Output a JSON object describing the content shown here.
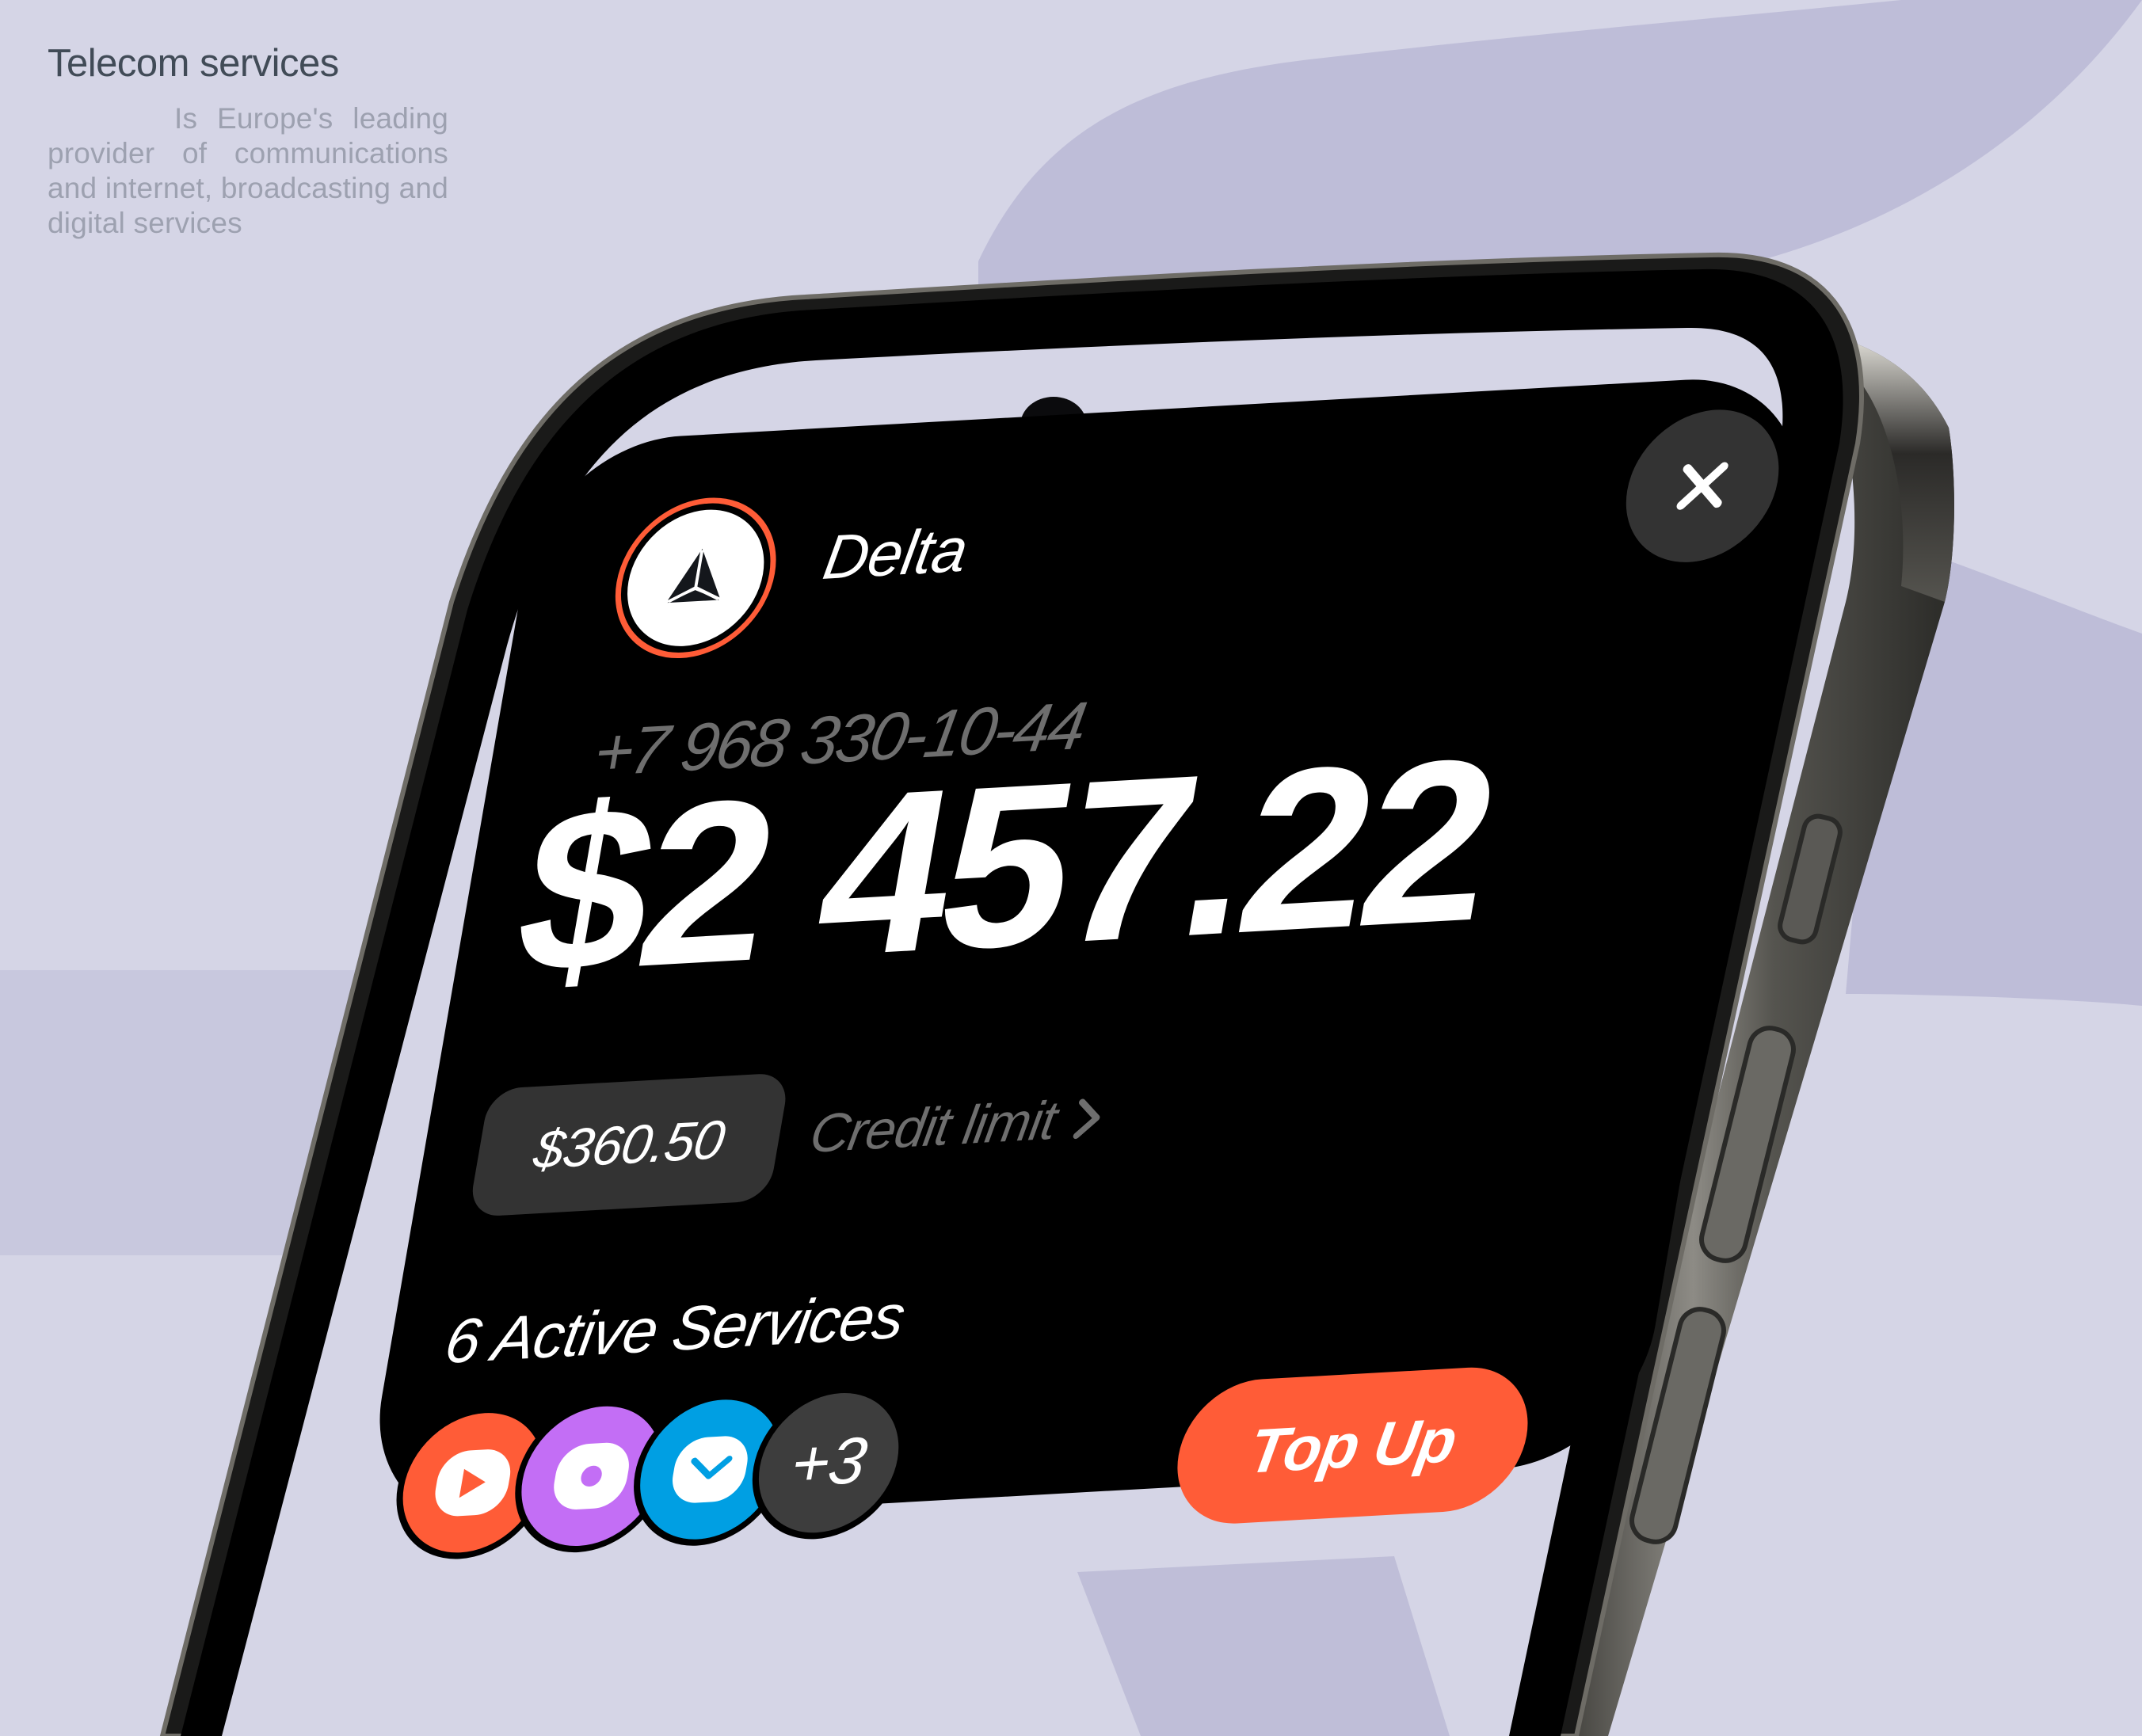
{
  "intro": {
    "title": "Telecom services",
    "description": "Is Europe's leading provider of communications and internet, broadcasting and digital services"
  },
  "widget": {
    "brand_name": "Delta",
    "close_icon": "close-icon",
    "phone_number": "+7 968 330-10-44",
    "balance": "$2 457.22",
    "credit_amount": "$360.50",
    "credit_label": "Credit limit",
    "credit_chevron": "chevron-right-icon",
    "services_title": "6 Active Services",
    "services": [
      {
        "name": "video-service",
        "icon": "play-icon",
        "color": "#ff5c37"
      },
      {
        "name": "music-service",
        "icon": "disc-icon",
        "color": "#c36ef5"
      },
      {
        "name": "mail-service",
        "icon": "mail-icon",
        "color": "#009fe3"
      }
    ],
    "more_services": "+3",
    "more_color": "#3d3d3d",
    "topup_label": "Top Up"
  },
  "colors": {
    "accent": "#ff5c37",
    "background": "#d5d5e6",
    "card": "#000000",
    "pill": "#333333"
  }
}
